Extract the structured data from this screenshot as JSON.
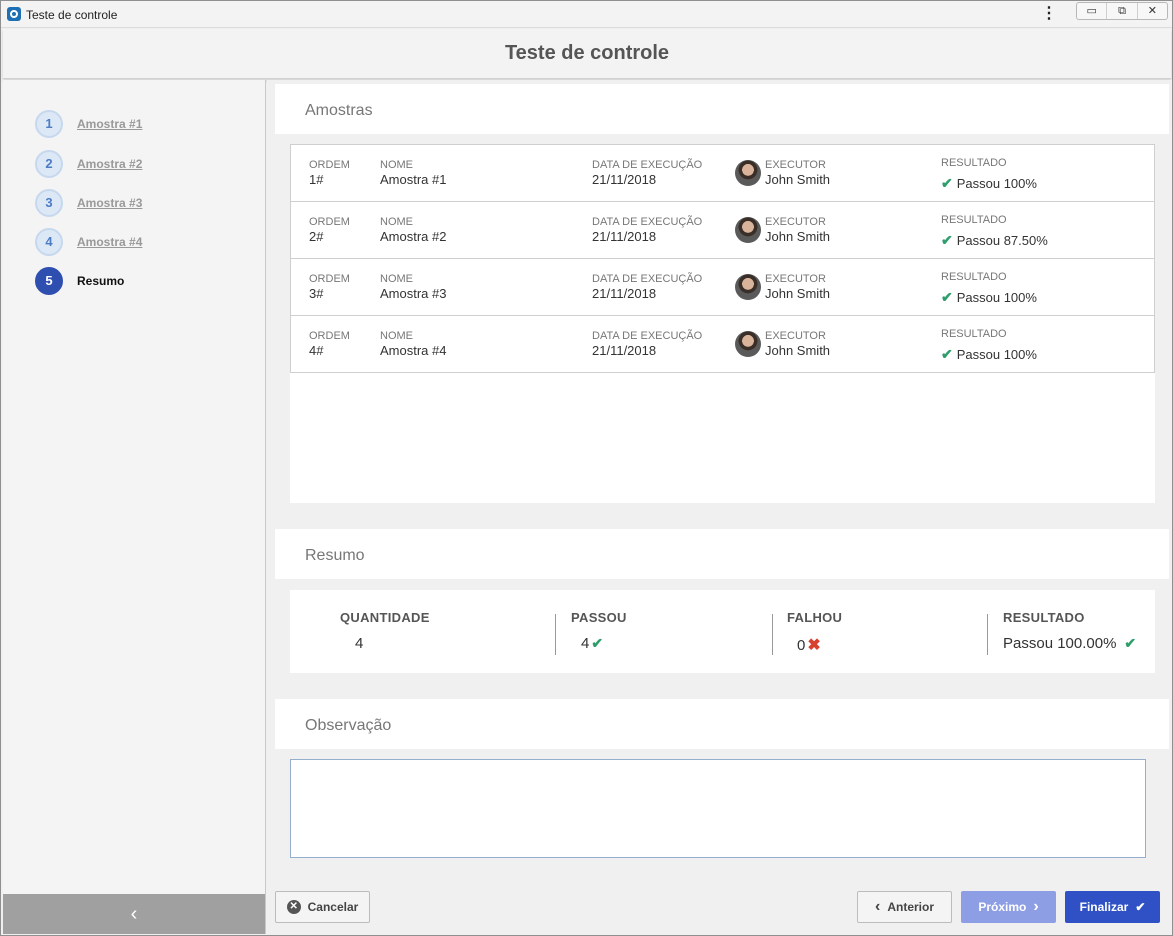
{
  "window": {
    "title": "Teste de controle",
    "controls": {
      "minimize": "▭",
      "maximize": "⧉",
      "close": "✕"
    }
  },
  "header": {
    "title": "Teste de controle"
  },
  "steps": [
    {
      "number": "1",
      "label": "Amostra #1",
      "active": false
    },
    {
      "number": "2",
      "label": "Amostra #2",
      "active": false
    },
    {
      "number": "3",
      "label": "Amostra #3",
      "active": false
    },
    {
      "number": "4",
      "label": "Amostra #4",
      "active": false
    },
    {
      "number": "5",
      "label": "Resumo",
      "active": true
    }
  ],
  "samples": {
    "title": "Amostras",
    "columns": {
      "ordem": "ORDEM",
      "nome": "NOME",
      "data": "DATA DE EXECUÇÃO",
      "executor": "EXECUTOR",
      "resultado": "RESULTADO"
    },
    "rows": [
      {
        "ordem": "1#",
        "nome": "Amostra #1",
        "data": "21/11/2018",
        "executor": "John Smith",
        "resultado": "Passou 100%"
      },
      {
        "ordem": "2#",
        "nome": "Amostra #2",
        "data": "21/11/2018",
        "executor": "John Smith",
        "resultado": "Passou 87.50%"
      },
      {
        "ordem": "3#",
        "nome": "Amostra #3",
        "data": "21/11/2018",
        "executor": "John Smith",
        "resultado": "Passou 100%"
      },
      {
        "ordem": "4#",
        "nome": "Amostra #4",
        "data": "21/11/2018",
        "executor": "John Smith",
        "resultado": "Passou 100%"
      }
    ]
  },
  "summary": {
    "title": "Resumo",
    "quantidade_label": "QUANTIDADE",
    "quantidade": "4",
    "passou_label": "PASSOU",
    "passou": "4",
    "falhou_label": "FALHOU",
    "falhou": "0",
    "resultado_label": "RESULTADO",
    "resultado": "Passou 100.00%"
  },
  "observation": {
    "title": "Observação",
    "value": ""
  },
  "footer": {
    "cancel_label": "Cancelar",
    "prev_label": "Anterior",
    "next_label": "Próximo",
    "finish_label": "Finalizar"
  },
  "colors": {
    "accent": "#2f51c5",
    "next_disabled": "#8e9ee4",
    "pass": "#2e9e6b",
    "fail": "#d9412f"
  }
}
